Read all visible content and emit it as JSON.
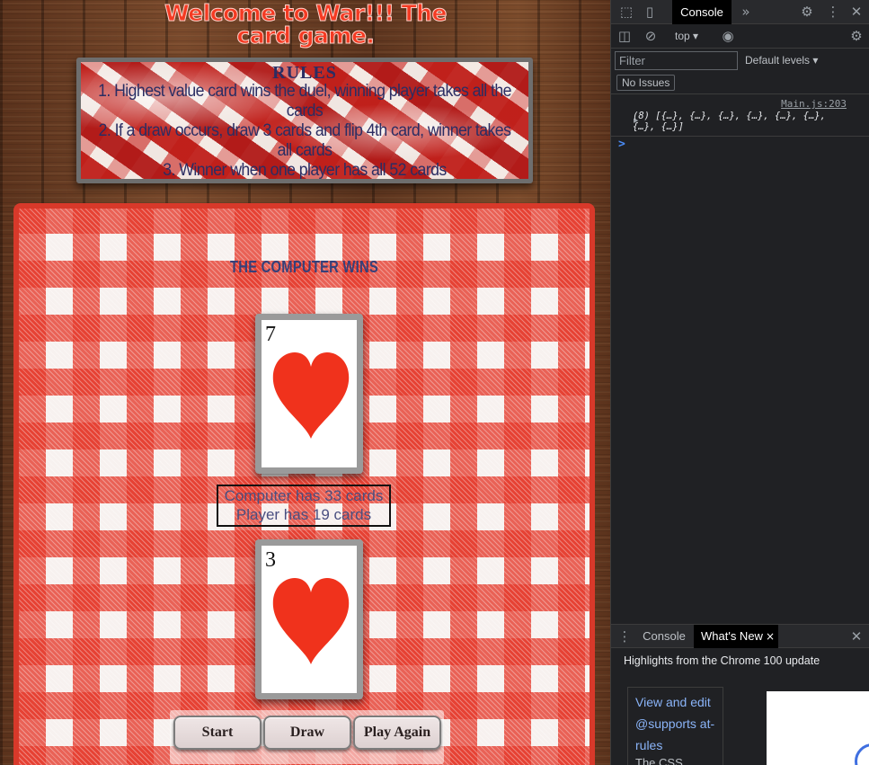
{
  "game": {
    "title": "Welcome to War!!! The card game.",
    "rules": {
      "heading": "RULES",
      "lines": [
        "1. Highest value card wins the duel, winning player takes all the cards",
        "2. If a draw occurs, draw 3 cards and flip 4th card, winner takes all cards",
        "3. Winner when one player has all 52 cards"
      ]
    },
    "result": "The Computer Wins",
    "computer_card": {
      "value": "7",
      "suit": "heart-icon",
      "color": "#f0321c"
    },
    "player_card": {
      "value": "3",
      "suit": "heart-icon",
      "color": "#f0321c"
    },
    "counts": {
      "computer": "Computer has 33 cards",
      "player": "Player has 19 cards"
    },
    "buttons": {
      "start": "Start",
      "draw": "Draw",
      "play_again": "Play Again"
    }
  },
  "devtools": {
    "active_tab": "Console",
    "more_tabs": "»",
    "context": "top",
    "filter_placeholder": "Filter",
    "levels": "Default levels",
    "issues": "No Issues",
    "log": {
      "source": "Main.js:203",
      "text": "(8) [{…}, {…}, {…}, {…}, {…}, {…}, {…}, {…}]"
    },
    "prompt": ">",
    "drawer": {
      "tabs": [
        "Console",
        "What's New"
      ],
      "close": "×",
      "highlights": "Highlights from the Chrome 100 update",
      "card_link": "View and edit @supports at-rules",
      "card_sub": "The CSS"
    }
  },
  "colors": {
    "title_red": "#f43a22",
    "rules_text": "#2b2d63",
    "tablecloth_red": "#e5392b",
    "heart_red": "#f0321c"
  }
}
